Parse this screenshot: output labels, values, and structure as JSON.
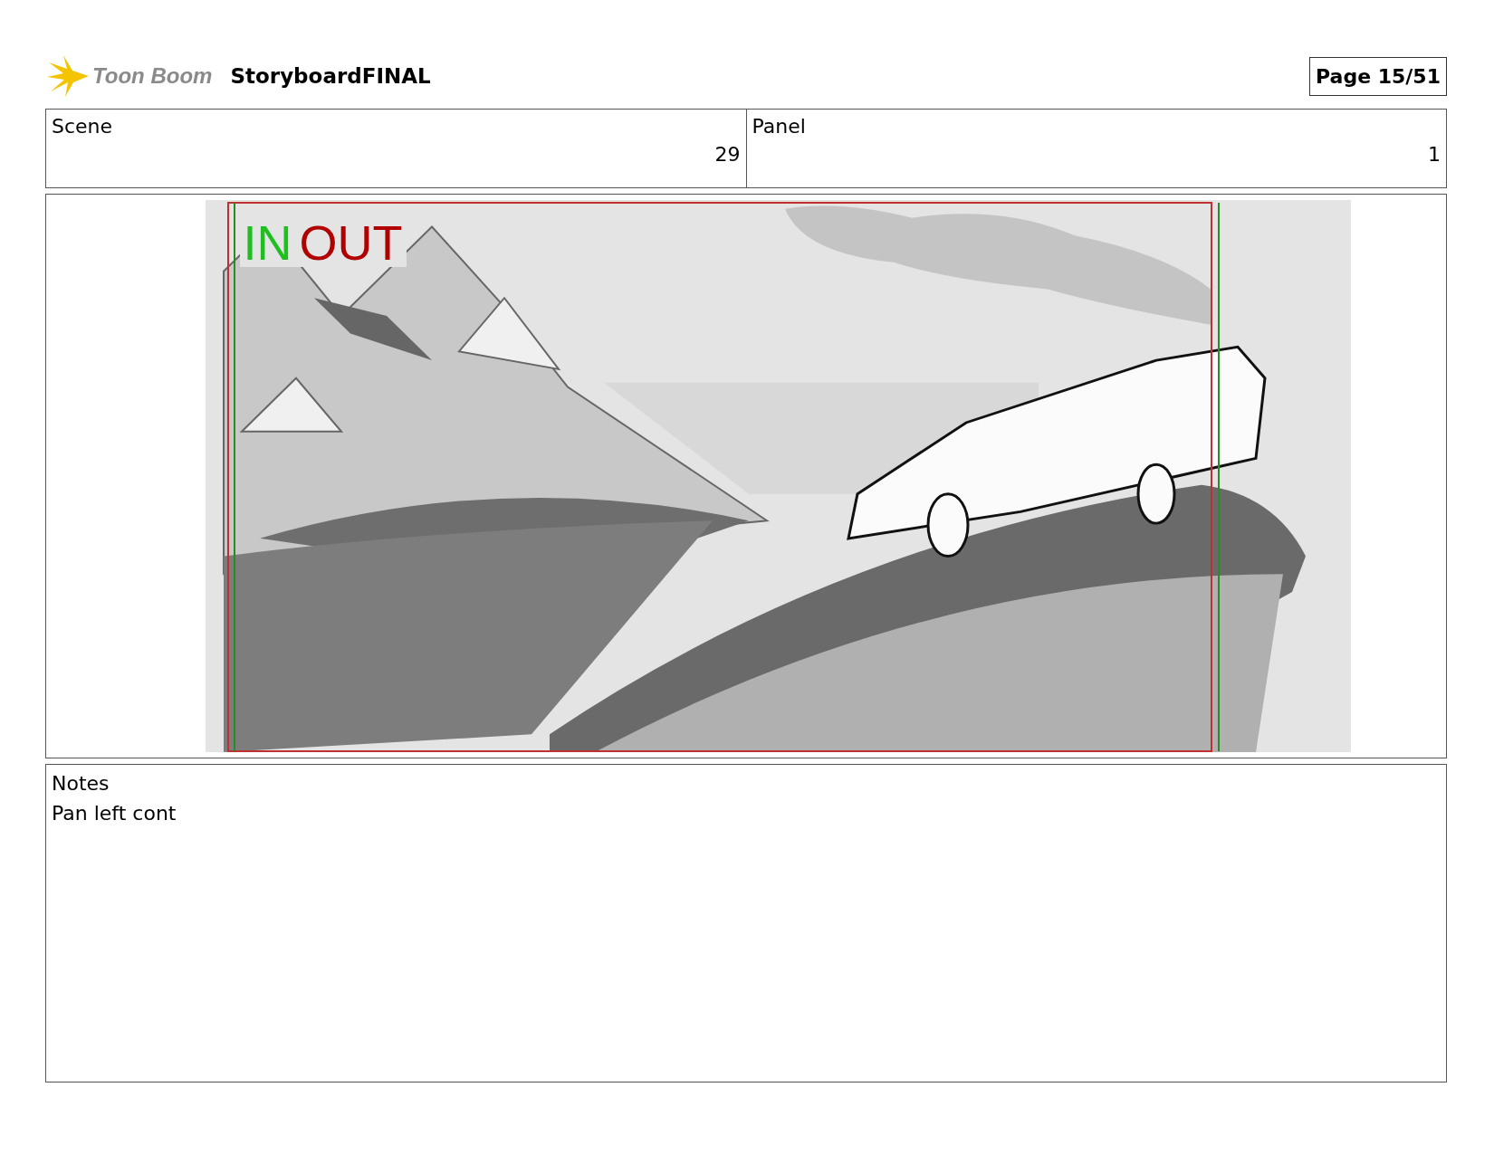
{
  "header": {
    "logo_text": "Toon Boom",
    "title": "StoryboardFINAL",
    "page": "Page 15/51"
  },
  "scene": {
    "label": "Scene",
    "value": "29"
  },
  "panel": {
    "label": "Panel",
    "value": "1"
  },
  "frame_labels": [
    {
      "text": "IN",
      "color": "#1fbf1f"
    },
    {
      "text": "OUT",
      "color": "#b00000"
    }
  ],
  "notes": {
    "label": "Notes",
    "text": "Pan left cont"
  }
}
